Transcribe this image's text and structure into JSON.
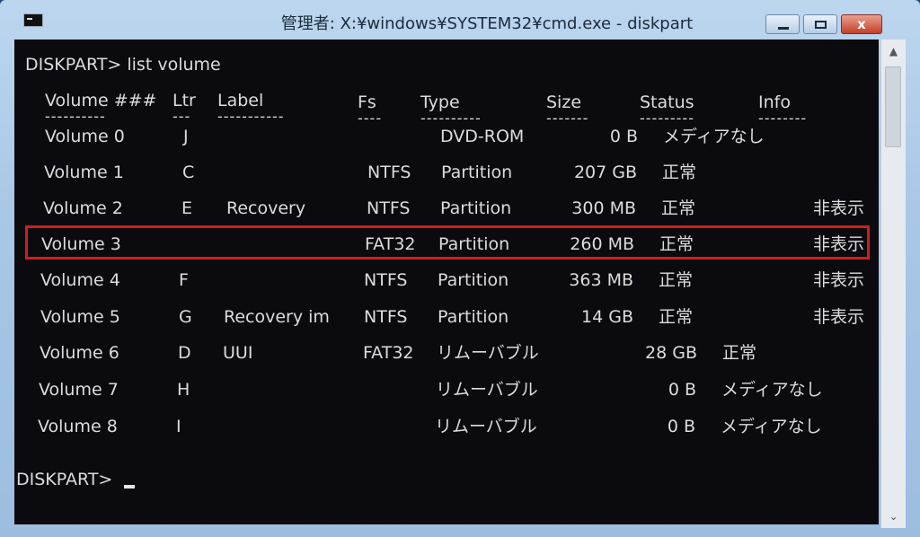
{
  "window": {
    "title": "管理者: X:¥windows¥SYSTEM32¥cmd.exe - diskpart",
    "close_glyph": "x"
  },
  "console": {
    "command_line": "DISKPART> list volume",
    "headers": {
      "volume": "Volume ###",
      "ltr": "Ltr",
      "label": "Label",
      "fs": "Fs",
      "type": "Type",
      "size": "Size",
      "status": "Status",
      "info": "Info"
    },
    "separators": {
      "volume": "----------",
      "ltr": "---",
      "label": "-----------",
      "fs": "----",
      "type": "----------",
      "size": "-------",
      "status": "---------",
      "info": "--------"
    },
    "rows": [
      {
        "volume": "Volume 0",
        "ltr": "J",
        "label": "",
        "fs": "",
        "type": "DVD-ROM",
        "size": "0 B",
        "status": "メディアなし",
        "info": ""
      },
      {
        "volume": "Volume 1",
        "ltr": "C",
        "label": "",
        "fs": "NTFS",
        "type": "Partition",
        "size": "207 GB",
        "status": "正常",
        "info": ""
      },
      {
        "volume": "Volume 2",
        "ltr": "E",
        "label": "Recovery",
        "fs": "NTFS",
        "type": "Partition",
        "size": "300 MB",
        "status": "正常",
        "info": "非表示"
      },
      {
        "volume": "Volume 3",
        "ltr": "",
        "label": "",
        "fs": "FAT32",
        "type": "Partition",
        "size": "260 MB",
        "status": "正常",
        "info": "非表示"
      },
      {
        "volume": "Volume 4",
        "ltr": "F",
        "label": "",
        "fs": "NTFS",
        "type": "Partition",
        "size": "363 MB",
        "status": "正常",
        "info": "非表示"
      },
      {
        "volume": "Volume 5",
        "ltr": "G",
        "label": "Recovery im",
        "fs": "NTFS",
        "type": "Partition",
        "size": "14 GB",
        "status": "正常",
        "info": "非表示"
      },
      {
        "volume": "Volume 6",
        "ltr": "D",
        "label": "UUI",
        "fs": "FAT32",
        "type": "リムーバブル",
        "size": "28 GB",
        "status": "正常",
        "info": ""
      },
      {
        "volume": "Volume 7",
        "ltr": "H",
        "label": "",
        "fs": "",
        "type": "リムーバブル",
        "size": "0 B",
        "status": "メディアなし",
        "info": ""
      },
      {
        "volume": "Volume 8",
        "ltr": "I",
        "label": "",
        "fs": "",
        "type": "リムーバブル",
        "size": "0 B",
        "status": "メディアなし",
        "info": ""
      }
    ],
    "prompt": "DISKPART>"
  },
  "colors": {
    "console_bg": "#0b0b0f",
    "console_text": "#dcdcdc",
    "highlight_border": "#d21c1c"
  }
}
